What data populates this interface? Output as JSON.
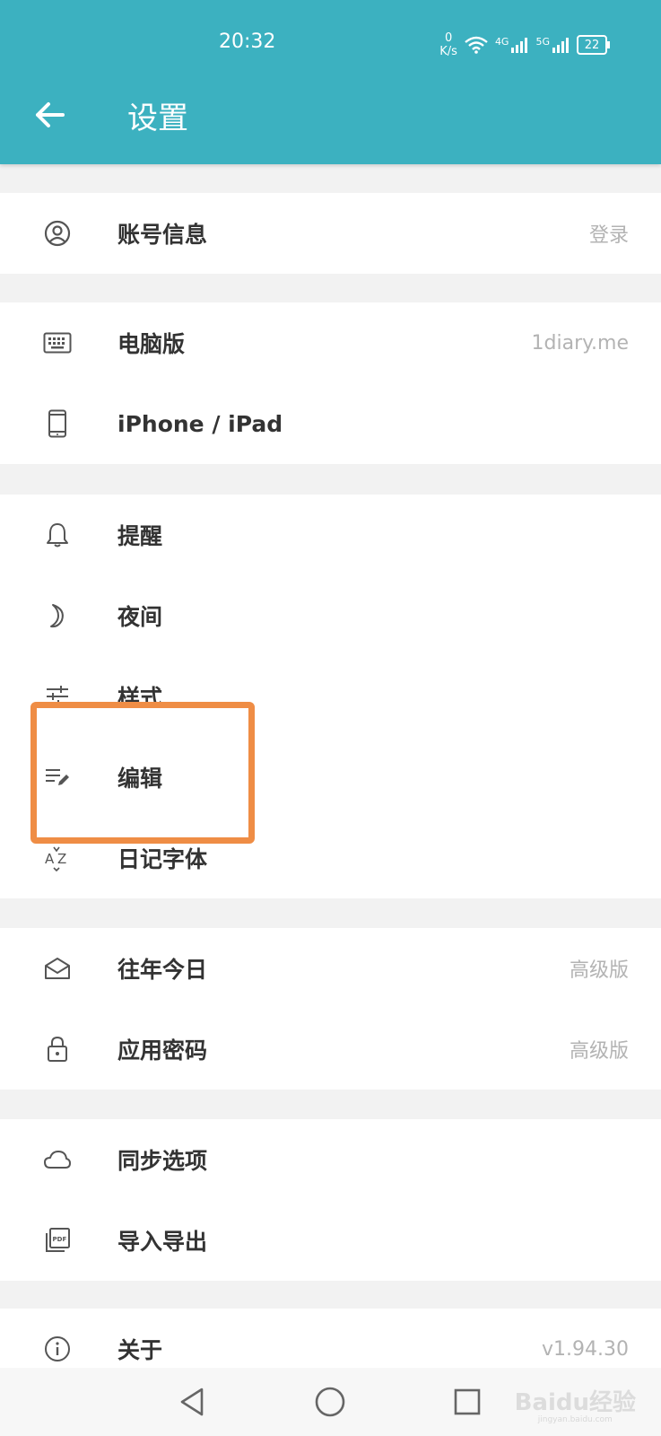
{
  "status_bar": {
    "time": "20:32",
    "speed_value": "0",
    "speed_unit": "K/s",
    "net1": "4G",
    "net2": "5G",
    "battery": "22"
  },
  "header": {
    "title": "设置"
  },
  "rows": {
    "account": {
      "label": "账号信息",
      "value": "登录"
    },
    "desktop": {
      "label": "电脑版",
      "value": "1diary.me"
    },
    "iphone": {
      "label": "iPhone / iPad"
    },
    "reminder": {
      "label": "提醒"
    },
    "night": {
      "label": "夜间"
    },
    "style": {
      "label": "样式"
    },
    "edit": {
      "label": "编辑"
    },
    "font": {
      "label": "日记字体"
    },
    "on_this_day": {
      "label": "往年今日",
      "value": "高级版"
    },
    "app_password": {
      "label": "应用密码",
      "value": "高级版"
    },
    "sync": {
      "label": "同步选项"
    },
    "import_export": {
      "label": "导入导出"
    },
    "about": {
      "label": "关于",
      "value": "v1.94.30"
    }
  },
  "watermark": {
    "text": "Baidu经验",
    "sub": "jingyan.baidu.com"
  },
  "colors": {
    "appbar": "#3cb1c0",
    "highlight": "#ef8d45",
    "background": "#f2f2f2"
  }
}
